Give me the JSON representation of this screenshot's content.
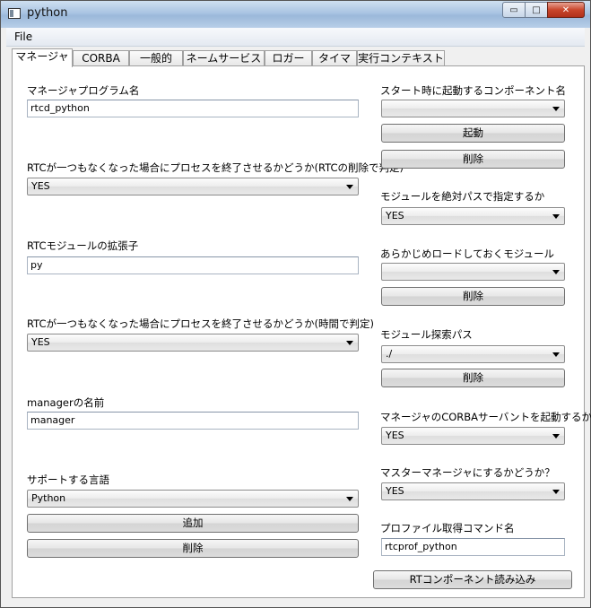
{
  "window": {
    "title": "python"
  },
  "titlebar_buttons": {
    "minimize": "▭",
    "maximize": "□",
    "close": "✕"
  },
  "menu": {
    "file_label": "File"
  },
  "tabs": [
    "マネージャ",
    "CORBA",
    "一般的",
    "ネームサービス",
    "ロガー",
    "タイマ",
    "実行コンテキスト"
  ],
  "left": {
    "manager_program_label": "マネージャプログラム名",
    "manager_program_value": "rtcd_python",
    "shutdown_on_rtc_deletion_label": "RTCが一つもなくなった場合にプロセスを終了させるかどうか(RTCの削除で判定)",
    "shutdown_on_rtc_deletion_value": "YES",
    "rtc_module_ext_label": "RTCモジュールの拡張子",
    "rtc_module_ext_value": "py",
    "shutdown_on_time_label": "RTCが一つもなくなった場合にプロセスを終了させるかどうか(時間で判定)",
    "shutdown_on_time_value": "YES",
    "manager_name_label": "managerの名前",
    "manager_name_value": "manager",
    "supported_lang_label": "サポートする言語",
    "supported_lang_value": "Python",
    "add_button": "追加",
    "delete_button": "削除"
  },
  "right": {
    "startup_component_label": "スタート時に起動するコンポーネント名",
    "startup_component_value": "",
    "launch_button": "起動",
    "delete_button_1": "削除",
    "abs_path_label": "モジュールを絶対パスで指定するか",
    "abs_path_value": "YES",
    "preload_label": "あらかじめロードしておくモジュール",
    "preload_value": "",
    "delete_button_2": "削除",
    "search_path_label": "モジュール探索パス",
    "search_path_value": "./",
    "delete_button_3": "削除",
    "corba_servant_label": "マネージャのCORBAサーバントを起動するか",
    "corba_servant_value": "YES",
    "master_manager_label": "マスターマネージャにするかどうか？",
    "master_manager_value": "YES",
    "profile_cmd_label": "プロファイル取得コマンド名",
    "profile_cmd_value": "rtcprof_python",
    "load_button": "RTコンポーネント読み込み"
  }
}
